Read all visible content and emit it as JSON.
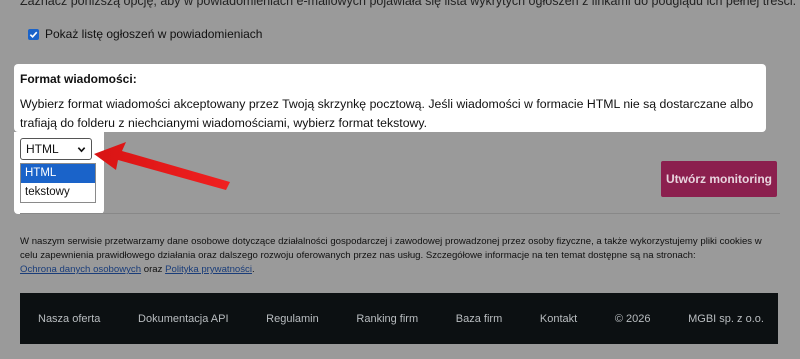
{
  "intro_text": "Zaznacz poniższą opcję, aby w powiadomieniach e-mailowych pojawiała się lista wykrytych ogłoszeń z linkami do podglądu ich pełnej treści.",
  "show_list_checkbox": {
    "label": "Pokaż listę ogłoszeń w powiadomieniach",
    "checked": true
  },
  "format": {
    "title": "Format wiadomości:",
    "description": "Wybierz format wiadomości akceptowany przez Twoją skrzynkę pocztową. Jeśli wiadomości w formacie HTML nie są dostarczane albo trafiają do folderu z niechcianymi wiadomościami, wybierz format tekstowy.",
    "selected": "HTML",
    "options": [
      "HTML",
      "tekstowy"
    ]
  },
  "create_button": "Utwórz monitoring",
  "privacy": {
    "text": "W naszym serwisie przetwarzamy dane osobowe dotyczące działalności gospodarczej i zawodowej prowadzonej przez osoby fizyczne, a także wykorzystujemy pliki cookies w celu zapewnienia prawidłowego działania oraz dalszego rozwoju oferowanych przez nas usług. Szczegółowe informacje na ten temat dostępne są na stronach:",
    "link1": "Ochrona danych osobowych",
    "connector": "oraz",
    "link2": "Polityka prywatności",
    "end": "."
  },
  "footer": [
    "Nasza oferta",
    "Dokumentacja API",
    "Regulamin",
    "Ranking firm",
    "Baza firm",
    "Kontakt",
    "© 2026",
    "MGBI sp. z o.o."
  ],
  "colors": {
    "accent_button": "#8b1f4e",
    "checkbox_blue": "#1a63c9",
    "arrow_red": "#e41b1b",
    "footer_bg": "#0c1012"
  }
}
